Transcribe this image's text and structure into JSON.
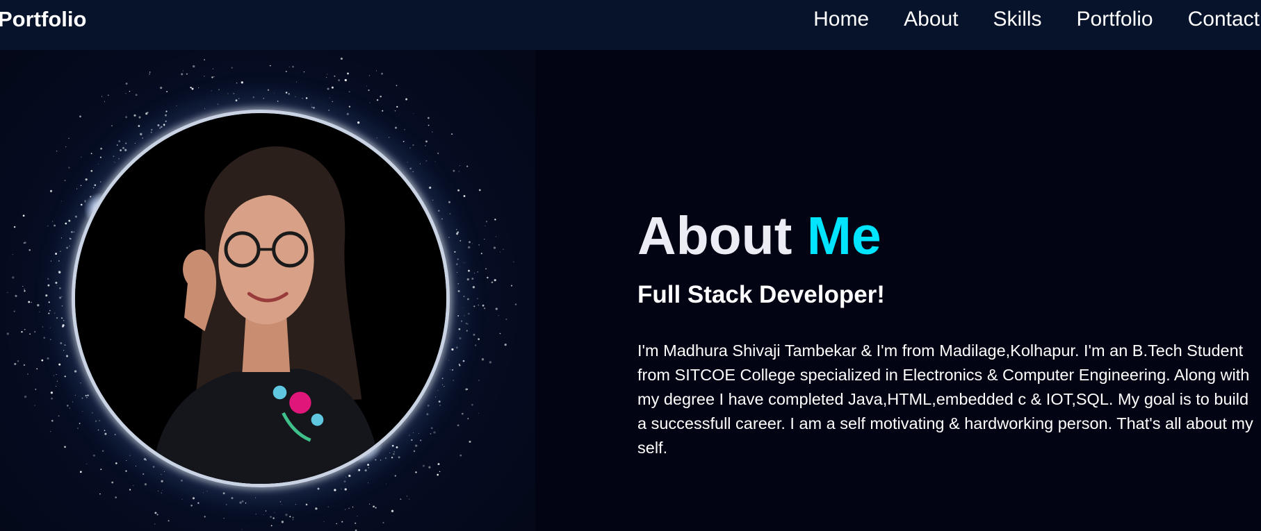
{
  "header": {
    "logo": "Portfolio",
    "nav": [
      "Home",
      "About",
      "Skills",
      "Portfolio",
      "Contact"
    ]
  },
  "profile": {
    "photo_description": "circular profile photo"
  },
  "about": {
    "title_main": "About",
    "title_accent": "Me",
    "subtitle": "Full Stack Developer!",
    "description": "I'm Madhura Shivaji Tambekar & I'm from Madilage,Kolhapur. I'm an B.Tech Student from SITCOE College specialized in Electronics & Computer Engineering. Along with my degree I have completed Java,HTML,embedded c & IOT,SQL. My goal is to build a successfull career. I am a self motivating & hardworking person. That's all about my self."
  },
  "colors": {
    "header_bg": "#07132a",
    "page_bg": "#020414",
    "accent": "#00e5ff"
  }
}
